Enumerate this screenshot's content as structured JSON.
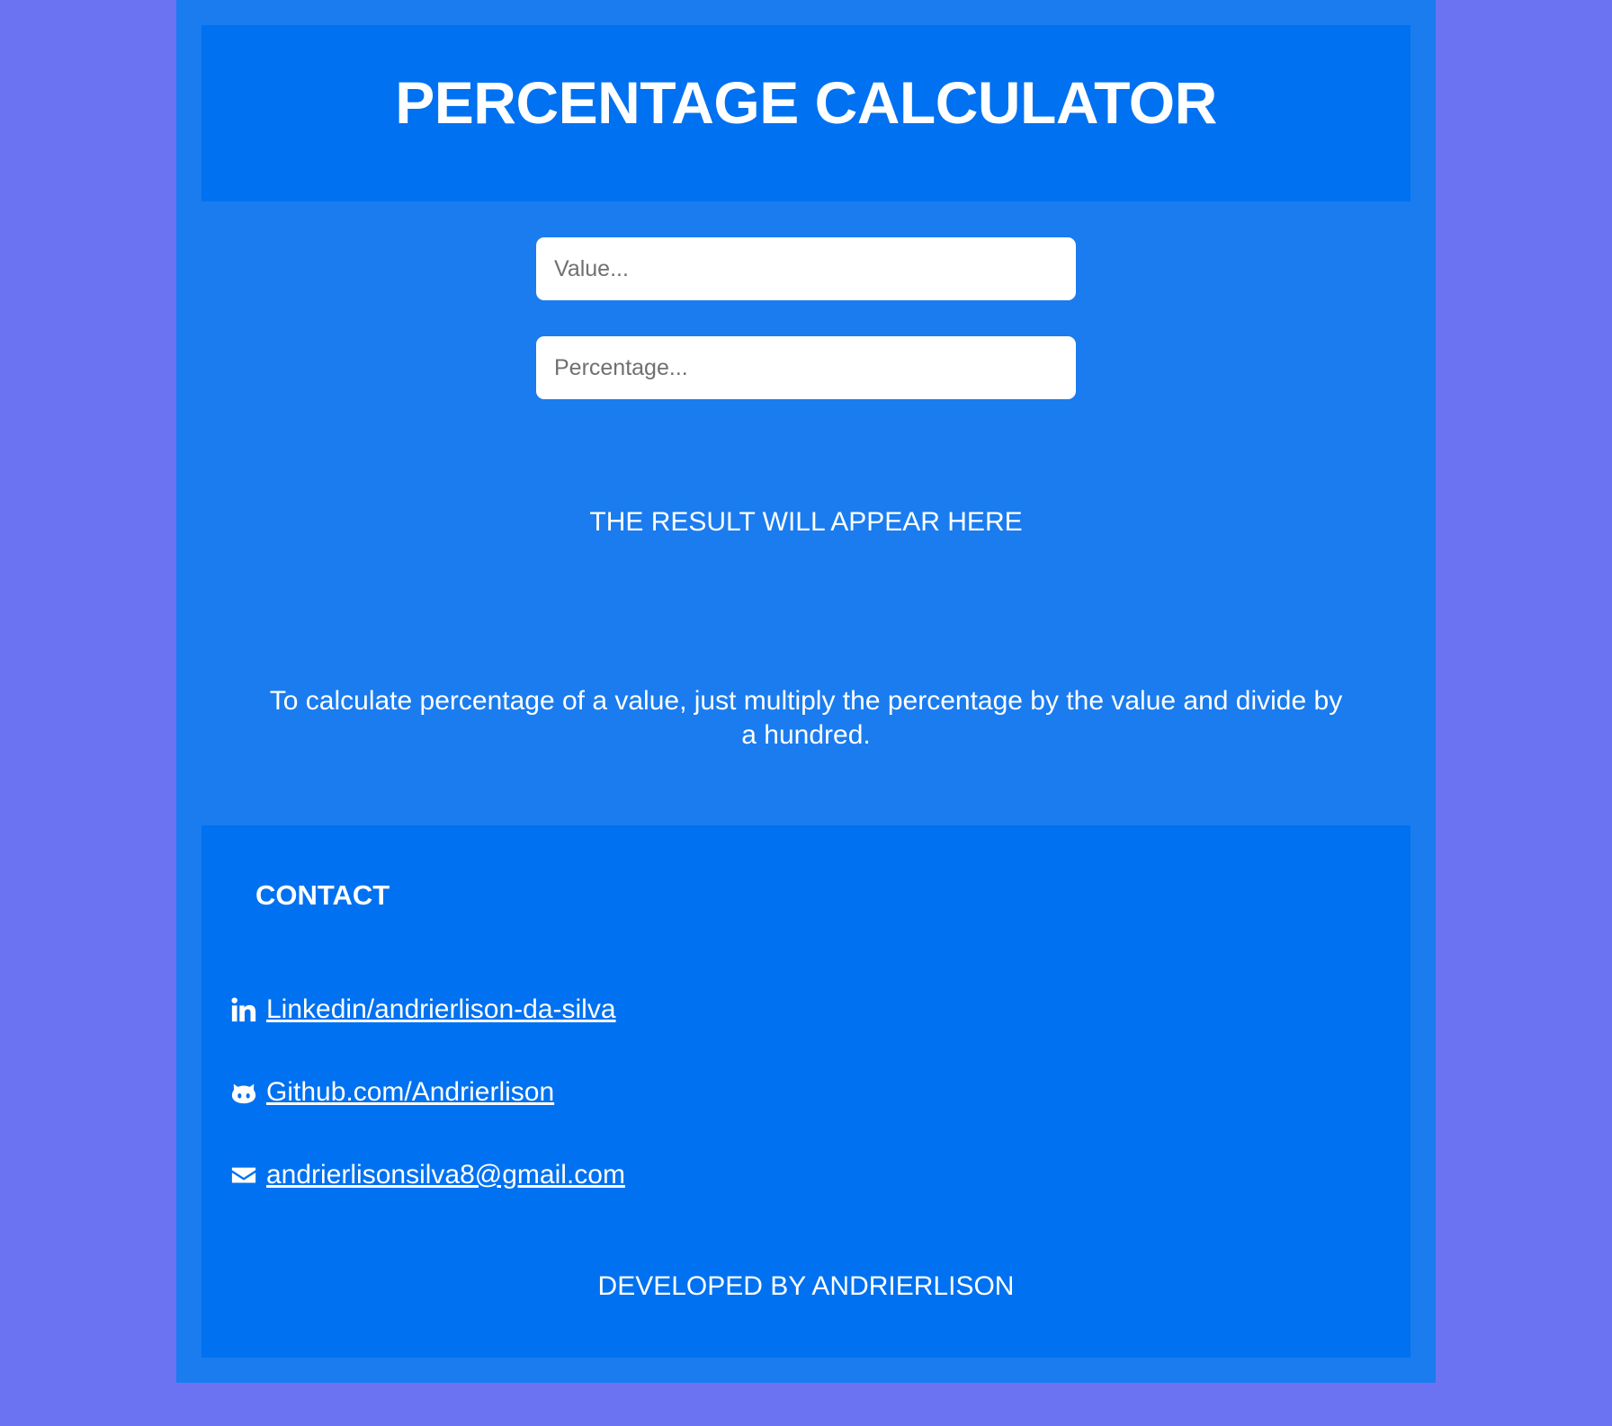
{
  "header": {
    "title": "PERCENTAGE CALCULATOR"
  },
  "form": {
    "value_placeholder": "Value...",
    "percentage_placeholder": "Percentage..."
  },
  "result": {
    "text": "THE RESULT WILL APPEAR HERE"
  },
  "explanation": {
    "text": "To calculate percentage of a value, just multiply the percentage by the value and divide by a hundred."
  },
  "footer": {
    "contact_title": "CONTACT",
    "links": [
      {
        "icon": "linkedin-icon",
        "label": " Linkedin/andrierlison-da-silva"
      },
      {
        "icon": "github-icon",
        "label": " Github.com/Andrierlison"
      },
      {
        "icon": "envelope-icon",
        "label": " andrierlisonsilva8@gmail.com"
      }
    ],
    "developed_by": "DEVELOPED BY ANDRIERLISON"
  },
  "colors": {
    "page_background": "#6c73f2",
    "container": "#1a7cef",
    "panel": "#0071f0",
    "text": "#ffffff"
  }
}
